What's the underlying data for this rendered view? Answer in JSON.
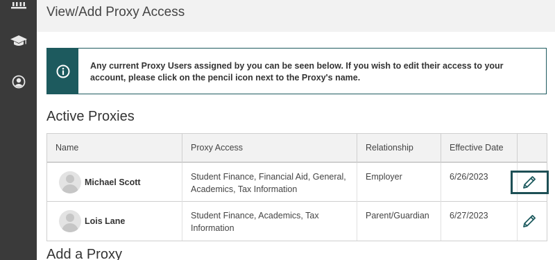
{
  "sidebar": {
    "icons": [
      "institution-icon",
      "graduation-cap-icon",
      "user-circle-icon"
    ]
  },
  "header": {
    "title": "View/Add Proxy Access"
  },
  "info": {
    "message": "Any current Proxy Users assigned by you can be seen below. If you wish to edit their access to your account, please click on the pencil icon next to the Proxy's name.",
    "icon": "info-icon"
  },
  "active_proxies": {
    "title": "Active Proxies",
    "columns": [
      "Name",
      "Proxy Access",
      "Relationship",
      "Effective Date",
      ""
    ],
    "rows": [
      {
        "name": "Michael Scott",
        "access": "Student Finance, Financial Aid, General, Academics, Tax Information",
        "relationship": "Employer",
        "effective_date": "6/26/2023",
        "edit_icon": "pencil-icon"
      },
      {
        "name": "Lois Lane",
        "access": "Student Finance, Academics, Tax Information",
        "relationship": "Parent/Guardian",
        "effective_date": "6/27/2023",
        "edit_icon": "pencil-icon"
      }
    ]
  },
  "add_proxy": {
    "title": "Add a Proxy"
  },
  "colors": {
    "sidebar": "#3a3a3a",
    "accent": "#1d5a5e",
    "header_bg": "#f2f2f2"
  }
}
